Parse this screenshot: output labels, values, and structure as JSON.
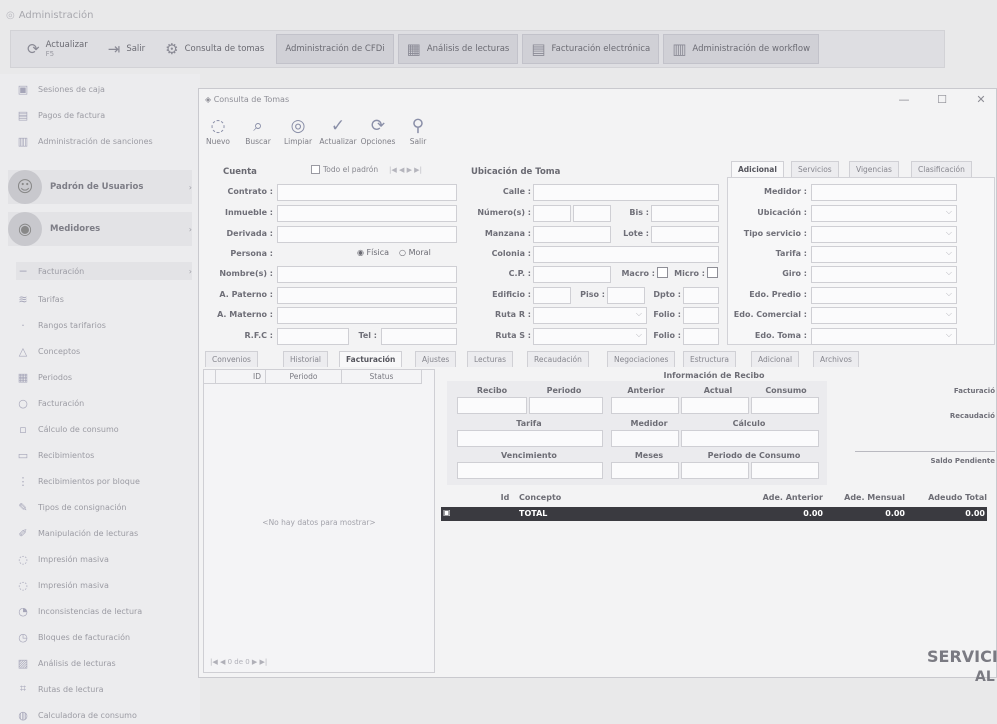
{
  "app": {
    "title": "Administración"
  },
  "ribbon": {
    "items": [
      {
        "label": "Actualizar",
        "sub": "F5"
      },
      {
        "label": "Salir",
        "sub": ""
      },
      {
        "label": "Consulta de tomas",
        "sub": ""
      },
      {
        "label": "Administración de CFDi",
        "sub": ""
      },
      {
        "label": "Análisis de lecturas",
        "sub": ""
      },
      {
        "label": "Facturación electrónica",
        "sub": ""
      },
      {
        "label": "Administración de workflow",
        "sub": ""
      }
    ]
  },
  "sidebar": {
    "items": [
      {
        "label": "Sesiones de caja",
        "icon": "cash-icon"
      },
      {
        "label": "Pagos de factura",
        "icon": "payment-icon"
      },
      {
        "label": "Administración de sanciones",
        "icon": "sanction-icon"
      },
      {
        "label": "Padrón de Usuarios",
        "icon": "users-icon"
      },
      {
        "label": "Medidores",
        "icon": "meter-icon"
      },
      {
        "label": "Facturación",
        "icon": "invoice-icon"
      },
      {
        "label": "Tarifas",
        "icon": "rate-icon"
      },
      {
        "label": "Rangos tarifarios",
        "icon": "ranges-icon"
      },
      {
        "label": "Conceptos",
        "icon": "concept-icon"
      },
      {
        "label": "Periodos",
        "icon": "calendar-icon"
      },
      {
        "label": "Facturación",
        "icon": "invoice-icon"
      },
      {
        "label": "Cálculo de consumo",
        "icon": "calc-icon"
      },
      {
        "label": "Recibimientos",
        "icon": "receive-icon"
      },
      {
        "label": "Recibimientos por bloque",
        "icon": "block-icon"
      },
      {
        "label": "Tipos de consignación",
        "icon": "type-icon"
      },
      {
        "label": "Manipulación de lecturas",
        "icon": "edit-icon"
      },
      {
        "label": "Impresión masiva",
        "icon": "print-icon"
      },
      {
        "label": "Impresión masiva",
        "icon": "print-icon"
      },
      {
        "label": "Inconsistencias de lectura",
        "icon": "warning-icon"
      },
      {
        "label": "Bloques de facturación",
        "icon": "blocks-icon"
      },
      {
        "label": "Análisis de lecturas",
        "icon": "analysis-icon"
      },
      {
        "label": "Rutas de lectura",
        "icon": "route-icon"
      },
      {
        "label": "Calculadora de consumo",
        "icon": "calculator-icon"
      }
    ]
  },
  "window": {
    "title": "Consulta de Tomas",
    "toolbar": [
      "Nuevo",
      "Buscar",
      "Limpiar",
      "Actualizar",
      "Opciones",
      "Salir"
    ],
    "cuenta": {
      "title": "Cuenta",
      "todo_padron": "Todo el padrón",
      "nav": "|◀  ◀  ▶  ▶|",
      "labels": [
        "Contrato :",
        "Inmueble :",
        "Derivada :",
        "Persona :",
        "Nombre(s) :",
        "A. Paterno :",
        "A. Materno :",
        "R.F.C :"
      ],
      "fisica": "Física",
      "moral": "Moral",
      "tel": "Tel :"
    },
    "ubicacion": {
      "title": "Ubicación de Toma",
      "labels": [
        "Calle :",
        "Número(s) :",
        "Manzana :",
        "Colonia :",
        "C.P. :",
        "Edificio :",
        "Ruta R :",
        "Ruta S :"
      ],
      "bis": "Bis :",
      "lote": "Lote :",
      "macro": "Macro :",
      "micro": "Micro :",
      "piso": "Piso :",
      "depto": "Dpto :",
      "folio_r": "Folio :",
      "folio_s": "Folio :"
    },
    "right_tabs": [
      "Adicional",
      "Servicios",
      "Vigencias",
      "Clasificación"
    ],
    "adicional": {
      "labels": [
        "Medidor :",
        "Ubicación :",
        "Tipo servicio :",
        "Tarifa :",
        "Giro :",
        "Edo. Predio :",
        "Edo. Comercial :",
        "Edo. Toma :"
      ]
    },
    "bottom_tabs": [
      "Convenios",
      "Historial",
      "Facturación",
      "Ajustes",
      "Lecturas",
      "Recaudación",
      "Negociaciones",
      "Estructura",
      "Adicional",
      "Archivos"
    ],
    "grid": {
      "columns": [
        "ID",
        "Periodo",
        "Status"
      ],
      "empty": "<No hay datos para mostrar>",
      "pager": "|◀  ◀   0 de 0   ▶  ▶|"
    },
    "recibo": {
      "title": "Información de Recibo",
      "row1": [
        "Recibo",
        "Periodo",
        "Anterior",
        "Actual",
        "Consumo"
      ],
      "row2": [
        "Tarifa",
        "Medidor",
        "Cálculo"
      ],
      "row3": [
        "Vencimiento",
        "Meses",
        "Periodo de Consumo"
      ],
      "side": [
        "Facturació",
        "Recaudació",
        "Saldo Pendiente"
      ]
    },
    "concepts": {
      "columns": [
        "Id",
        "Concepto",
        "Ade. Anterior",
        "Ade. Mensual",
        "Adeudo Total"
      ],
      "total_label": "TOTAL",
      "totals": [
        "0.00",
        "0.00",
        "0.00"
      ]
    },
    "watermark": [
      "SERVICI",
      "AL"
    ]
  }
}
